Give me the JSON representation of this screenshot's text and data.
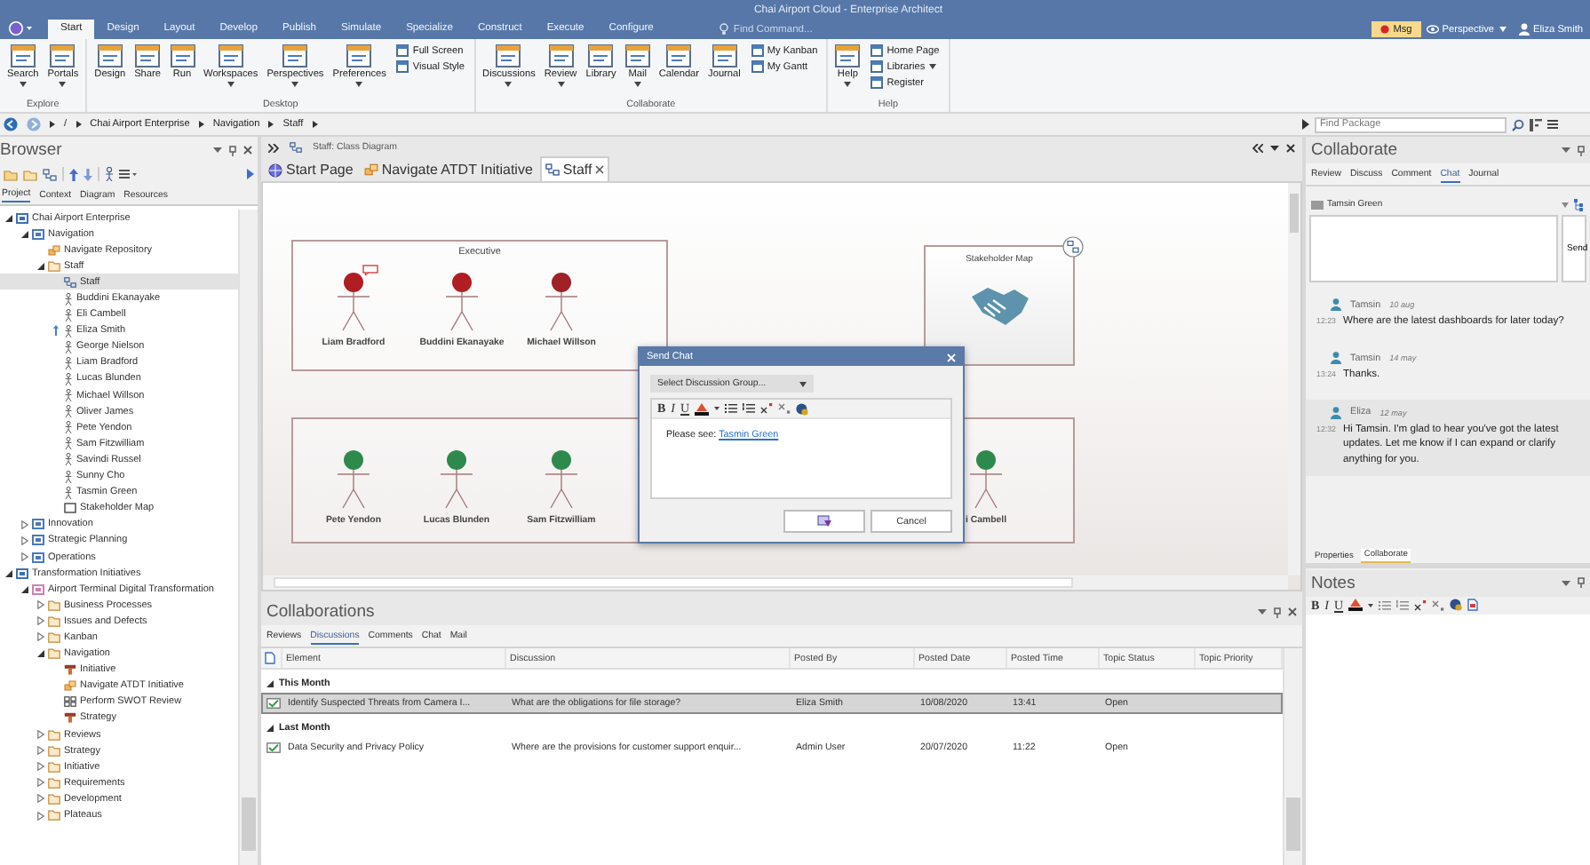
{
  "window": {
    "title": "Chai Airport Cloud - Enterprise Architect"
  },
  "ribbon_tabs": [
    {
      "label": "Start",
      "selected": true
    },
    {
      "label": "Design",
      "selected": false
    },
    {
      "label": "Layout",
      "selected": false
    },
    {
      "label": "Develop",
      "selected": false
    },
    {
      "label": "Publish",
      "selected": false
    },
    {
      "label": "Simulate",
      "selected": false
    },
    {
      "label": "Specialize",
      "selected": false
    },
    {
      "label": "Construct",
      "selected": false
    },
    {
      "label": "Execute",
      "selected": false
    },
    {
      "label": "Configure",
      "selected": false
    }
  ],
  "find_command": {
    "placeholder": "Find Command..."
  },
  "account": {
    "msg": "Msg",
    "perspective": "Perspective",
    "user": "Eliza Smith"
  },
  "ribbon_groups": [
    {
      "label": "Explore",
      "buttons": [
        {
          "label": "Search",
          "dropdown": true
        },
        {
          "label": "Portals",
          "dropdown": true
        }
      ]
    },
    {
      "label": "Desktop",
      "buttons": [
        {
          "label": "Design",
          "dropdown": false
        },
        {
          "label": "Share",
          "dropdown": false
        },
        {
          "label": "Run",
          "dropdown": false
        },
        {
          "label": "Workspaces",
          "dropdown": true
        },
        {
          "label": "Perspectives",
          "dropdown": true
        },
        {
          "label": "Preferences",
          "dropdown": true
        }
      ],
      "small_buttons": [
        {
          "label": "Full Screen",
          "dropdown": false
        },
        {
          "label": "Visual Style",
          "dropdown": false
        }
      ]
    },
    {
      "label": "Collaborate",
      "buttons": [
        {
          "label": "Discussions",
          "dropdown": true
        },
        {
          "label": "Review",
          "dropdown": true
        },
        {
          "label": "Library",
          "dropdown": false
        },
        {
          "label": "Mail",
          "dropdown": true
        },
        {
          "label": "Calendar",
          "dropdown": false
        },
        {
          "label": "Journal",
          "dropdown": false
        }
      ],
      "small_buttons": [
        {
          "label": "My Kanban",
          "dropdown": false
        },
        {
          "label": "My Gantt",
          "dropdown": false
        }
      ]
    },
    {
      "label": "Help",
      "buttons": [
        {
          "label": "Help",
          "dropdown": true
        }
      ],
      "small_buttons": [
        {
          "label": "Home Page",
          "dropdown": false
        },
        {
          "label": "Libraries",
          "dropdown": true
        },
        {
          "label": "Register",
          "dropdown": false
        }
      ]
    }
  ],
  "breadcrumb": [
    "/",
    "Chai Airport Enterprise",
    "Navigation",
    "Staff"
  ],
  "find_package": {
    "placeholder": "Find Package"
  },
  "browser": {
    "title": "Browser",
    "tabs": [
      {
        "label": "Project",
        "selected": true
      },
      {
        "label": "Context",
        "selected": false
      },
      {
        "label": "Diagram",
        "selected": false
      },
      {
        "label": "Resources",
        "selected": false
      }
    ],
    "tree": [
      {
        "label": "Chai Airport Enterprise",
        "kind": "model",
        "selected": false,
        "expanded": true,
        "children": [
          {
            "label": "Navigation",
            "kind": "view",
            "selected": false,
            "expanded": true,
            "children": [
              {
                "label": "Navigate Repository",
                "kind": "navigator",
                "selected": false
              },
              {
                "label": "Staff",
                "kind": "folder",
                "selected": false,
                "expanded": true,
                "children": [
                  {
                    "label": "Staff",
                    "kind": "diagram",
                    "selected": true
                  },
                  {
                    "label": "Buddini Ekanayake",
                    "kind": "actor",
                    "selected": false,
                    "marked": false
                  },
                  {
                    "label": "Eli Cambell",
                    "kind": "actor",
                    "selected": false,
                    "marked": false
                  },
                  {
                    "label": "Eliza Smith",
                    "kind": "actor",
                    "selected": false,
                    "marked": true
                  },
                  {
                    "label": "George Nielson",
                    "kind": "actor",
                    "selected": false,
                    "marked": false
                  },
                  {
                    "label": "Liam Bradford",
                    "kind": "actor",
                    "selected": false,
                    "marked": false
                  },
                  {
                    "label": "Lucas Blunden",
                    "kind": "actor",
                    "selected": false,
                    "marked": false
                  },
                  {
                    "label": "Michael Willson",
                    "kind": "actor",
                    "selected": false,
                    "marked": false
                  },
                  {
                    "label": "Oliver James",
                    "kind": "actor",
                    "selected": false,
                    "marked": false
                  },
                  {
                    "label": "Pete Yendon",
                    "kind": "actor",
                    "selected": false,
                    "marked": false
                  },
                  {
                    "label": "Sam Fitzwilliam",
                    "kind": "actor",
                    "selected": false,
                    "marked": false
                  },
                  {
                    "label": "Savindi Russel",
                    "kind": "actor",
                    "selected": false,
                    "marked": false
                  },
                  {
                    "label": "Sunny Cho",
                    "kind": "actor",
                    "selected": false,
                    "marked": false
                  },
                  {
                    "label": "Tasmin Green",
                    "kind": "actor",
                    "selected": false,
                    "marked": false
                  },
                  {
                    "label": "Stakeholder Map",
                    "kind": "boundary",
                    "selected": false
                  }
                ]
              }
            ]
          },
          {
            "label": "Innovation",
            "kind": "view",
            "selected": false,
            "expanded": false
          },
          {
            "label": "Strategic Planning",
            "kind": "view",
            "selected": false,
            "expanded": false
          },
          {
            "label": "Operations",
            "kind": "view",
            "selected": false,
            "expanded": false
          }
        ]
      },
      {
        "label": "Transformation Initiatives",
        "kind": "model",
        "selected": false,
        "expanded": true,
        "children": [
          {
            "label": "Airport Terminal Digital Transformation",
            "kind": "package",
            "selected": false,
            "expanded": true,
            "children": [
              {
                "label": "Business Processes",
                "kind": "folder",
                "selected": false,
                "expanded": false
              },
              {
                "label": "Issues and Defects",
                "kind": "folder",
                "selected": false,
                "expanded": false
              },
              {
                "label": "Kanban",
                "kind": "folder",
                "selected": false,
                "expanded": false
              },
              {
                "label": "Navigation",
                "kind": "folder",
                "selected": false,
                "expanded": true,
                "children": [
                  {
                    "label": "Initiative",
                    "kind": "element",
                    "selected": false
                  },
                  {
                    "label": "Navigate ATDT Initiative",
                    "kind": "navigator",
                    "selected": false
                  },
                  {
                    "label": "Perform SWOT Review",
                    "kind": "pattern",
                    "selected": false
                  },
                  {
                    "label": "Strategy",
                    "kind": "element",
                    "selected": false
                  }
                ]
              },
              {
                "label": "Reviews",
                "kind": "folder",
                "selected": false,
                "expanded": false
              },
              {
                "label": "Strategy",
                "kind": "folder",
                "selected": false,
                "expanded": false
              },
              {
                "label": "Initiative",
                "kind": "folder",
                "selected": false,
                "expanded": false
              },
              {
                "label": "Requirements",
                "kind": "folder",
                "selected": false,
                "expanded": false
              },
              {
                "label": "Development",
                "kind": "folder",
                "selected": false,
                "expanded": false
              },
              {
                "label": "Plateaus",
                "kind": "folder",
                "selected": false,
                "expanded": false
              }
            ]
          }
        ]
      }
    ]
  },
  "diagram": {
    "header": "Staff:  Class Diagram",
    "tabs": [
      {
        "label": "Start Page",
        "kind": "start",
        "selected": false
      },
      {
        "label": "Navigate ATDT Initiative",
        "kind": "navigator",
        "selected": false
      },
      {
        "label": "Staff",
        "kind": "diagram",
        "selected": true
      }
    ],
    "boundaries": [
      {
        "label": "Executive",
        "actors": [
          {
            "name": "Liam Bradford",
            "color": "#b01e24",
            "note": true
          },
          {
            "name": "Buddini Ekanayake",
            "color": "#b01e24",
            "note": false
          },
          {
            "name": "Michael Willson",
            "color": "#9e2226",
            "note": false
          }
        ]
      },
      {
        "actors": [
          {
            "name": "Pete Yendon",
            "color": "#2e8a4c",
            "note": false
          },
          {
            "name": "Lucas Blunden",
            "color": "#2e8a4c",
            "note": false
          },
          {
            "name": "Sam Fitzwilliam",
            "color": "#2e8a4c",
            "note": false
          },
          {
            "name": "i Cambell",
            "color": "#2e8a4c",
            "note": false
          }
        ]
      }
    ],
    "stakeholder_map": {
      "label": "Stakeholder Map"
    },
    "dialog": {
      "title": "Send Chat",
      "group_select": {
        "placeholder": "Select Discussion Group..."
      },
      "format_buttons": [
        "B",
        "I",
        "U"
      ],
      "message": {
        "prefix": "Please see: ",
        "link": "Tasmin Green"
      },
      "buttons": [
        {
          "kind": "icon"
        },
        {
          "kind": "text",
          "label": "Cancel"
        }
      ]
    }
  },
  "collaborations": {
    "title": "Collaborations",
    "tabs": [
      {
        "label": "Reviews",
        "selected": false
      },
      {
        "label": "Discussions",
        "selected": true
      },
      {
        "label": "Comments",
        "selected": false
      },
      {
        "label": "Chat",
        "selected": false
      },
      {
        "label": "Mail",
        "selected": false
      }
    ],
    "columns": [
      "Element",
      "Discussion",
      "Posted By",
      "Posted Date",
      "Posted Time",
      "Topic Status",
      "Topic Priority"
    ],
    "groups": [
      {
        "label": "This Month",
        "rows": [
          {
            "selected": true,
            "cells": [
              "Identify Suspected Threats from Camera I...",
              "What are the obligations for file storage?",
              "Eliza Smith",
              "10/08/2020",
              "13:41",
              "Open"
            ]
          }
        ]
      },
      {
        "label": "Last Month",
        "rows": [
          {
            "selected": false,
            "cells": [
              "Data Security and Privacy Policy",
              "Where are the provisions for customer support enquir...",
              "Admin User",
              "20/07/2020",
              "11:22",
              "Open"
            ]
          }
        ]
      }
    ]
  },
  "collaborate": {
    "title": "Collaborate",
    "tabs": [
      {
        "label": "Review",
        "selected": false
      },
      {
        "label": "Discuss",
        "selected": false
      },
      {
        "label": "Comment",
        "selected": false
      },
      {
        "label": "Chat",
        "selected": true
      },
      {
        "label": "Journal",
        "selected": false
      }
    ],
    "recipient": "Tamsin Green",
    "send": "Send",
    "messages": [
      {
        "author": "Tamsin",
        "date": "10 aug",
        "time": "12:23",
        "text": "Where are the latest dashboards for later today?",
        "kind": "received"
      },
      {
        "author": "Tamsin",
        "date": "14 may",
        "time": "13:24",
        "text": "Thanks.",
        "kind": "received"
      },
      {
        "author": "Eliza",
        "date": "12 may",
        "time": "12:32",
        "text": "Hi Tamsin. I'm glad to hear you've got the latest updates. Let me know if I can expand or clarify anything for you.",
        "kind": "sent"
      }
    ],
    "bottom_tabs": [
      {
        "label": "Properties",
        "selected": false
      },
      {
        "label": "Collaborate",
        "selected": true
      }
    ]
  },
  "notes": {
    "title": "Notes",
    "format_buttons": [
      "B",
      "I",
      "U"
    ]
  }
}
